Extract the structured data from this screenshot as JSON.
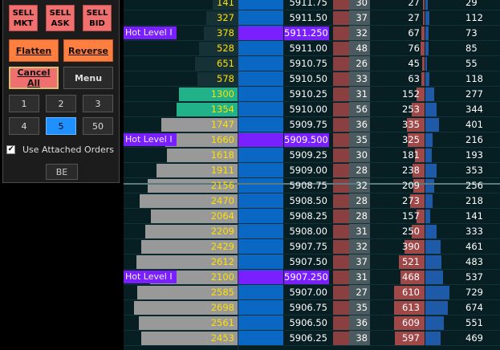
{
  "panel": {
    "sell_mkt": [
      "SELL",
      "MKT"
    ],
    "sell_ask": [
      "SELL",
      "ASK"
    ],
    "sell_bid": [
      "SELL",
      "BID"
    ],
    "flatten": "Flatten",
    "reverse": "Reverse",
    "cancel_all": "Cancel All",
    "menu": "Menu",
    "qty": [
      "1",
      "2",
      "3",
      "4",
      "5",
      "50"
    ],
    "qty_selected": "5",
    "use_attached_orders": "Use Attached Orders",
    "use_attached_checked": true,
    "be": "BE"
  },
  "colors": {
    "bid_volume": "#ffe000",
    "hot_level": "#7a1fff",
    "ask_bar": "#0a67c4",
    "bid_bar": "#a04848"
  },
  "hot_level_label": "Hot Level I",
  "rows": [
    {
      "vol": "141",
      "vb": 0.22,
      "price": "5911.75",
      "trades": "30",
      "bid": "27",
      "ask": "29",
      "bb": 0.04,
      "ab": 0.05
    },
    {
      "vol": "327",
      "vb": 0.28,
      "price": "5911.50",
      "trades": "37",
      "bid": "27",
      "ask": "112",
      "bb": 0.04,
      "ab": 0.08
    },
    {
      "vol": "378",
      "vb": 0.3,
      "price": "5911.250",
      "trades": "32",
      "bid": "67",
      "ask": "73",
      "bb": 0.1,
      "ab": 0.06,
      "hot": true
    },
    {
      "vol": "528",
      "vb": 0.34,
      "price": "5911.00",
      "trades": "48",
      "bid": "76",
      "ask": "85",
      "bb": 0.12,
      "ab": 0.06
    },
    {
      "vol": "651",
      "vb": 0.38,
      "price": "5910.75",
      "trades": "26",
      "bid": "45",
      "ask": "55",
      "bb": 0.08,
      "ab": 0.04
    },
    {
      "vol": "578",
      "vb": 0.36,
      "price": "5910.50",
      "trades": "33",
      "bid": "63",
      "ask": "118",
      "bb": 0.1,
      "ab": 0.08
    },
    {
      "vol": "1300",
      "vb": 0.52,
      "price": "5910.25",
      "trades": "31",
      "bid": "152",
      "ask": "277",
      "bb": 0.25,
      "ab": 0.18
    },
    {
      "vol": "1354",
      "vb": 0.54,
      "price": "5910.00",
      "trades": "56",
      "bid": "253",
      "ask": "344",
      "bb": 0.4,
      "ab": 0.24
    },
    {
      "vol": "1747",
      "vb": 0.68,
      "price": "5909.75",
      "trades": "36",
      "bid": "335",
      "ask": "401",
      "bb": 0.55,
      "ab": 0.28
    },
    {
      "vol": "1660",
      "vb": 0.64,
      "price": "5909.500",
      "trades": "35",
      "bid": "325",
      "ask": "216",
      "bb": 0.52,
      "ab": 0.15,
      "hot": true
    },
    {
      "vol": "1618",
      "vb": 0.63,
      "price": "5909.25",
      "trades": "30",
      "bid": "181",
      "ask": "193",
      "bb": 0.3,
      "ab": 0.13
    },
    {
      "vol": "1911",
      "vb": 0.72,
      "price": "5909.00",
      "trades": "28",
      "bid": "238",
      "ask": "353",
      "bb": 0.38,
      "ab": 0.24
    },
    {
      "vol": "2156",
      "vb": 0.8,
      "price": "5908.75",
      "trades": "32",
      "bid": "209",
      "ask": "256",
      "bb": 0.34,
      "ab": 0.18
    },
    {
      "vol": "2470",
      "vb": 0.87,
      "price": "5908.50",
      "trades": "28",
      "bid": "273",
      "ask": "218",
      "bb": 0.44,
      "ab": 0.15
    },
    {
      "vol": "2064",
      "vb": 0.77,
      "price": "5908.25",
      "trades": "28",
      "bid": "157",
      "ask": "141",
      "bb": 0.26,
      "ab": 0.1
    },
    {
      "vol": "2209",
      "vb": 0.82,
      "price": "5908.00",
      "trades": "31",
      "bid": "250",
      "ask": "333",
      "bb": 0.4,
      "ab": 0.23
    },
    {
      "vol": "2429",
      "vb": 0.86,
      "price": "5907.75",
      "trades": "32",
      "bid": "390",
      "ask": "461",
      "bb": 0.62,
      "ab": 0.32
    },
    {
      "vol": "2612",
      "vb": 0.9,
      "price": "5907.50",
      "trades": "37",
      "bid": "521",
      "ask": "483",
      "bb": 0.8,
      "ab": 0.33
    },
    {
      "vol": "2100",
      "vb": 0.78,
      "price": "5907.250",
      "trades": "31",
      "bid": "468",
      "ask": "537",
      "bb": 0.74,
      "ab": 0.37,
      "hot": true
    },
    {
      "vol": "2585",
      "vb": 0.89,
      "price": "5907.00",
      "trades": "27",
      "bid": "610",
      "ask": "729",
      "bb": 0.95,
      "ab": 0.5
    },
    {
      "vol": "2698",
      "vb": 0.92,
      "price": "5906.75",
      "trades": "35",
      "bid": "613",
      "ask": "674",
      "bb": 0.95,
      "ab": 0.46
    },
    {
      "vol": "2561",
      "vb": 0.88,
      "price": "5906.50",
      "trades": "36",
      "bid": "609",
      "ask": "551",
      "bb": 0.95,
      "ab": 0.38
    },
    {
      "vol": "2453",
      "vb": 0.86,
      "price": "5906.25",
      "trades": "38",
      "bid": "597",
      "ask": "469",
      "bb": 0.93,
      "ab": 0.32
    }
  ]
}
